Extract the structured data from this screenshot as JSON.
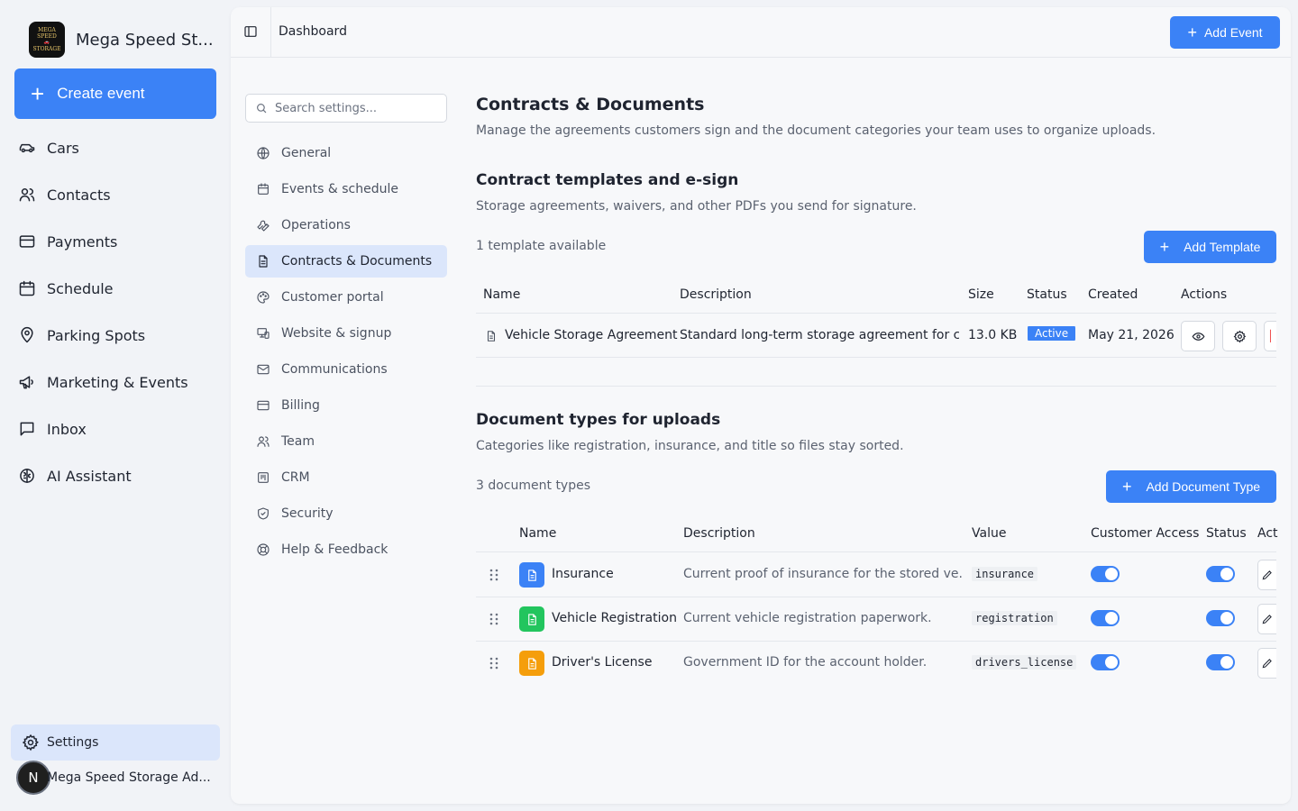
{
  "app": {
    "name": "Mega Speed St...",
    "logo_text_top": "MEGA SPEED",
    "logo_text_bottom": "STORAGE",
    "create_button": "Create event"
  },
  "sidebar": {
    "items": [
      {
        "label": "Cars",
        "icon": "car-icon"
      },
      {
        "label": "Contacts",
        "icon": "users-icon"
      },
      {
        "label": "Payments",
        "icon": "credit-card-icon"
      },
      {
        "label": "Schedule",
        "icon": "calendar-icon"
      },
      {
        "label": "Parking Spots",
        "icon": "map-pin-icon"
      },
      {
        "label": "Marketing & Events",
        "icon": "megaphone-icon"
      },
      {
        "label": "Inbox",
        "icon": "message-square-icon"
      },
      {
        "label": "AI Assistant",
        "icon": "brain-icon"
      }
    ],
    "settings_label": "Settings",
    "user_initial": "N",
    "user_name": "Mega Speed Storage Ad..."
  },
  "topbar": {
    "breadcrumb": "Dashboard",
    "add_event": "Add Event"
  },
  "settings_nav": {
    "search_placeholder": "Search settings...",
    "items": [
      {
        "label": "General",
        "icon": "globe-icon"
      },
      {
        "label": "Events & schedule",
        "icon": "calendar-icon"
      },
      {
        "label": "Operations",
        "icon": "wrench-icon"
      },
      {
        "label": "Contracts & Documents",
        "icon": "file-text-icon",
        "active": true
      },
      {
        "label": "Customer portal",
        "icon": "palette-icon"
      },
      {
        "label": "Website & signup",
        "icon": "monitor-smartphone-icon"
      },
      {
        "label": "Communications",
        "icon": "mail-icon"
      },
      {
        "label": "Billing",
        "icon": "credit-card-icon"
      },
      {
        "label": "Team",
        "icon": "users-icon"
      },
      {
        "label": "CRM",
        "icon": "kanban-icon"
      },
      {
        "label": "Security",
        "icon": "shield-icon"
      },
      {
        "label": "Help & Feedback",
        "icon": "life-buoy-icon"
      }
    ]
  },
  "page": {
    "title": "Contracts & Documents",
    "subtitle": "Manage the agreements customers sign and the document categories your team uses to organize uploads."
  },
  "templates": {
    "title": "Contract templates and e-sign",
    "subtitle": "Storage agreements, waivers, and other PDFs you send for signature.",
    "count_text": "1 template available",
    "add_button": "Add Template",
    "columns": [
      "Name",
      "Description",
      "Size",
      "Status",
      "Created",
      "Actions"
    ],
    "rows": [
      {
        "name": "Vehicle Storage Agreement",
        "description": "Standard long-term storage agreement for c...",
        "size": "13.0 KB",
        "status": "Active",
        "created": "May 21, 2026"
      }
    ]
  },
  "doc_types": {
    "title": "Document types for uploads",
    "subtitle": "Categories like registration, insurance, and title so files stay sorted.",
    "count_text": "3 document types",
    "add_button": "Add Document Type",
    "columns": [
      "Name",
      "Description",
      "Value",
      "Customer Access",
      "Status",
      "Act"
    ],
    "rows": [
      {
        "name": "Insurance",
        "description": "Current proof of insurance for the stored ve...",
        "value": "insurance",
        "color": "#3b82f6",
        "customer_access": true,
        "status": true
      },
      {
        "name": "Vehicle Registration",
        "description": "Current vehicle registration paperwork.",
        "value": "registration",
        "color": "#22c55e",
        "customer_access": true,
        "status": true
      },
      {
        "name": "Driver's License",
        "description": "Government ID for the account holder.",
        "value": "drivers_license",
        "color": "#f59e0b",
        "customer_access": true,
        "status": true
      }
    ]
  },
  "colors": {
    "accent": "#3b82f6",
    "active_nav_bg": "#dbe6fb"
  }
}
